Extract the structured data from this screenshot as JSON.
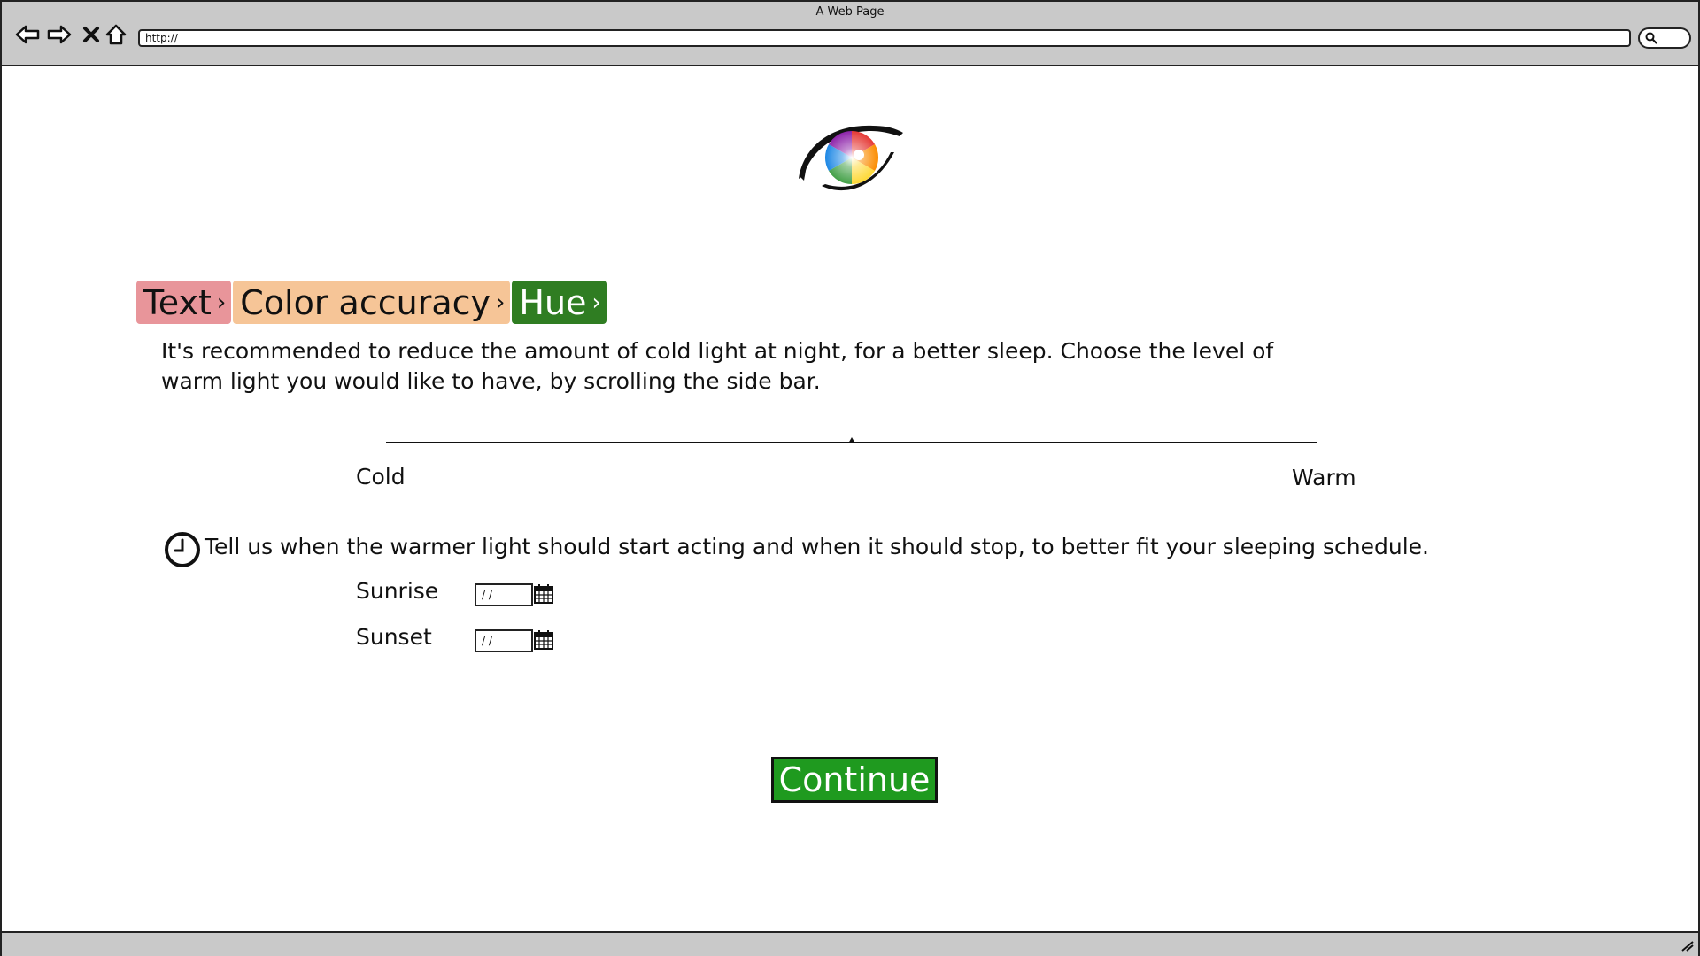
{
  "window": {
    "title": "A Web Page"
  },
  "browser": {
    "url": "http://",
    "icons": [
      "back-arrow-icon",
      "forward-arrow-icon",
      "close-icon",
      "home-icon",
      "search-icon"
    ]
  },
  "logo": {
    "icon": "eye-logo-icon",
    "colors": [
      "#e53935",
      "#fb8c00",
      "#fdd835",
      "#43a047",
      "#1e88e5",
      "#8e24aa"
    ]
  },
  "breadcrumb": {
    "items": [
      {
        "label": "Text",
        "color": "#e8959a"
      },
      {
        "label": "Color accuracy",
        "color": "#f6c597"
      },
      {
        "label": "Hue",
        "color": "#2f7d22"
      }
    ],
    "separator": "›"
  },
  "intro": {
    "text": "It's recommended to reduce the amount of cold light at night, for a better sleep. Choose the level of warm light you would like to have, by scrolling the side bar."
  },
  "warmth_slider": {
    "value": 0.5,
    "min_label": "Cold",
    "max_label": "Warm"
  },
  "schedule": {
    "icon": "clock-icon",
    "text": "Tell us when the warmer light should start acting and when it should stop, to better fit your sleeping schedule.",
    "sunrise": {
      "label": "Sunrise",
      "value": "/ /"
    },
    "sunset": {
      "label": "Sunset",
      "value": "/ /"
    }
  },
  "actions": {
    "continue_label": "Continue",
    "continue_color": "#1f9a1f"
  }
}
